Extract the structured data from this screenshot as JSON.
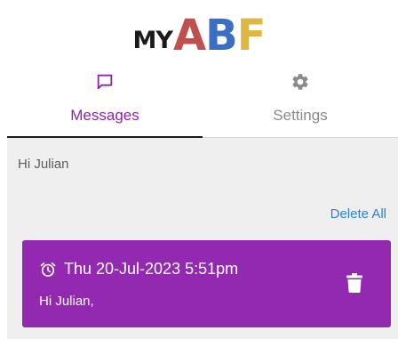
{
  "logo": {
    "prefix": "MY",
    "letters": [
      {
        "char": "A",
        "color": "#c0504d"
      },
      {
        "char": "B",
        "color": "#3b6fc4"
      },
      {
        "char": "F",
        "color": "#e0b640"
      }
    ]
  },
  "tabs": [
    {
      "label": "Messages",
      "icon": "message-icon",
      "active": true
    },
    {
      "label": "Settings",
      "icon": "gear-icon",
      "active": false
    }
  ],
  "inbox": {
    "greeting": "Hi Julian",
    "delete_all_label": "Delete All"
  },
  "messages": [
    {
      "timestamp": "Thu 20-Jul-2023 5:51pm",
      "body": "Hi Julian,",
      "icon": "alarm-clock-icon"
    }
  ],
  "colors": {
    "accent": "#8e24aa",
    "card": "#9329b0",
    "link": "#2f80d6"
  }
}
